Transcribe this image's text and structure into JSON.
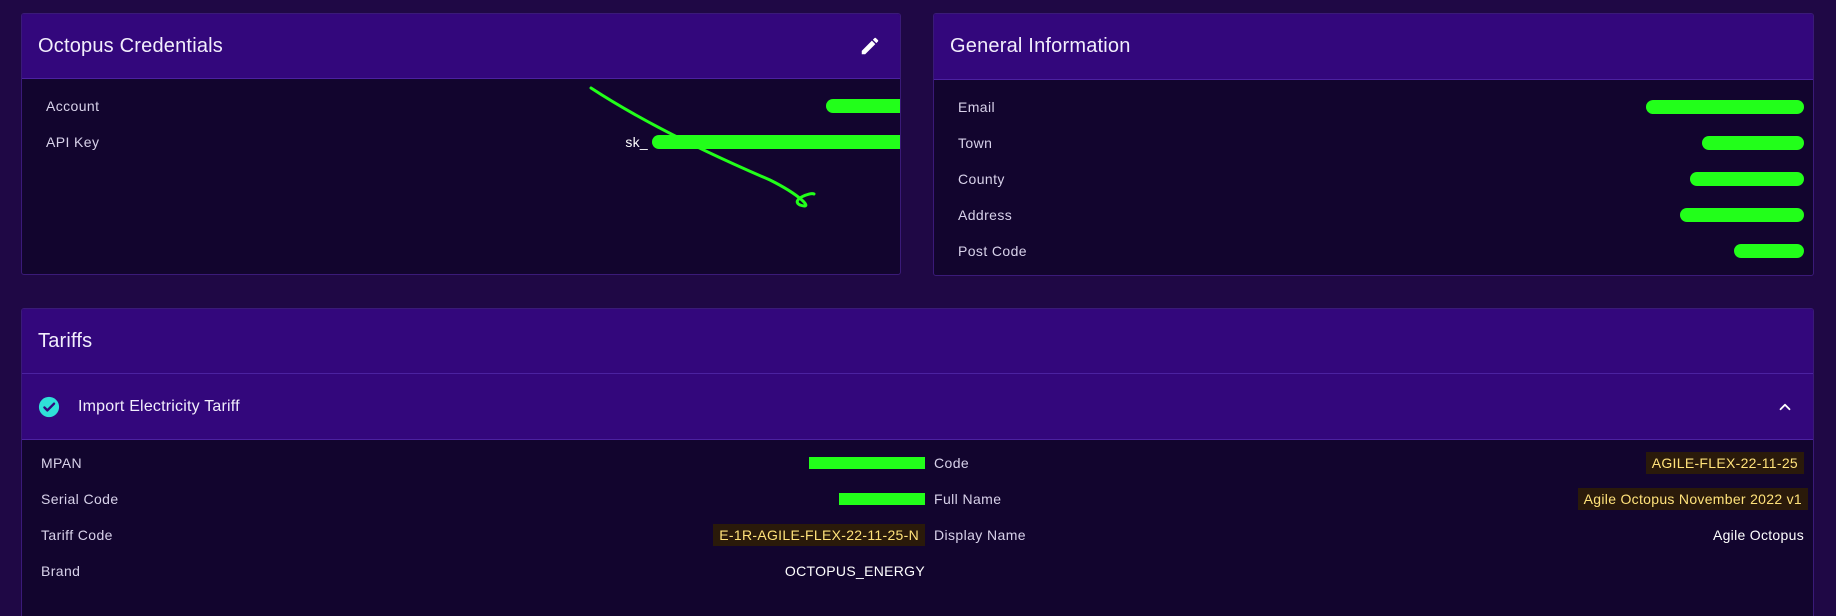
{
  "credentials": {
    "title": "Octopus Credentials",
    "rows": [
      {
        "label": "Account",
        "value": ""
      },
      {
        "label": "API Key",
        "value": "sk_"
      }
    ]
  },
  "general": {
    "title": "General Information",
    "rows": [
      {
        "label": "Email"
      },
      {
        "label": "Town"
      },
      {
        "label": "County"
      },
      {
        "label": "Address"
      },
      {
        "label": "Post Code"
      }
    ]
  },
  "tariffs": {
    "title": "Tariffs",
    "import": {
      "title": "Import Electricity Tariff",
      "left": [
        {
          "label": "MPAN",
          "value": ""
        },
        {
          "label": "Serial Code",
          "value": ""
        },
        {
          "label": "Tariff Code",
          "value": "E-1R-AGILE-FLEX-22-11-25-N"
        },
        {
          "label": "Brand",
          "value": "OCTOPUS_ENERGY"
        }
      ],
      "right": [
        {
          "label": "Code",
          "value": "AGILE-FLEX-22-11-25"
        },
        {
          "label": "Full Name",
          "value": "Agile Octopus November 2022 v1"
        },
        {
          "label": "Display Name",
          "value": "Agile Octopus"
        }
      ]
    }
  },
  "colors": {
    "background": "#1f0845",
    "header": "#33077c",
    "card": "#12052e",
    "redaction": "#22ff1a",
    "badge_text": "#ffe27a",
    "check": "#2fe0d8"
  },
  "icons": {
    "edit": "pencil-icon",
    "status": "check-circle-icon",
    "collapse": "chevron-up-icon"
  }
}
